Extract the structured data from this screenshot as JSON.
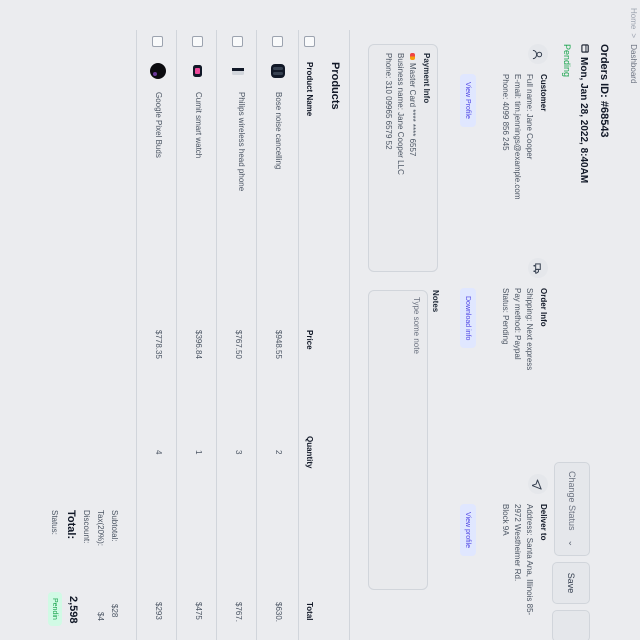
{
  "breadcrumb": [
    "Home",
    "Dashboard"
  ],
  "order": {
    "id_label": "Orders ID: #68543",
    "date": "Mon, Jan 28, 2022, 8:40AM",
    "status": "Pending"
  },
  "actions": {
    "change_status": "Change Status",
    "save": "Save"
  },
  "customer": {
    "title": "Customer",
    "lines": [
      "Full name: Jane Cooper",
      "E-mail: tim.jennings@example.com",
      "Phone: 4099 856 245"
    ],
    "button": "View Profile"
  },
  "order_info": {
    "title": "Order Info",
    "lines": [
      "Shipping: Next express",
      "Pay method: Paypal",
      "Status: Pending"
    ],
    "button": "Download info"
  },
  "deliver_to": {
    "title": "Deliver to",
    "lines": [
      "Address: Santa Ana, Illinois 85-",
      "2972 Westheimer Rd.",
      "Block 9A"
    ],
    "button": "View profile"
  },
  "payment": {
    "title": "Payment Info",
    "lines": [
      "Master Card **** **** 6557",
      "Business name: Jane Cooper LLC",
      "Phone: 310 09965 6579 52"
    ]
  },
  "notes": {
    "title": "Notes",
    "placeholder": "Type some note"
  },
  "products": {
    "title": "Products",
    "headers": [
      "Product Name",
      "Price",
      "Quantity",
      "Total"
    ],
    "rows": [
      {
        "name": "Bose noise cancelling",
        "price": "$948.55",
        "qty": "2",
        "total": "$630."
      },
      {
        "name": "Philips wireless head phone",
        "price": "$767.50",
        "qty": "3",
        "total": "$767."
      },
      {
        "name": "Cumit smart watch",
        "price": "$396.84",
        "qty": "1",
        "total": "$475"
      },
      {
        "name": "Google Pixel Buds",
        "price": "$778.35",
        "qty": "4",
        "total": "$293"
      }
    ]
  },
  "totals": {
    "subtotal_label": "Subtotal:",
    "subtotal": "$28",
    "tax_label": "Tax(20%):",
    "tax": "$4",
    "discount_label": "Discount:",
    "total_label": "Total:",
    "total": "2,598",
    "status_label": "Status:",
    "status": "Pendin"
  }
}
